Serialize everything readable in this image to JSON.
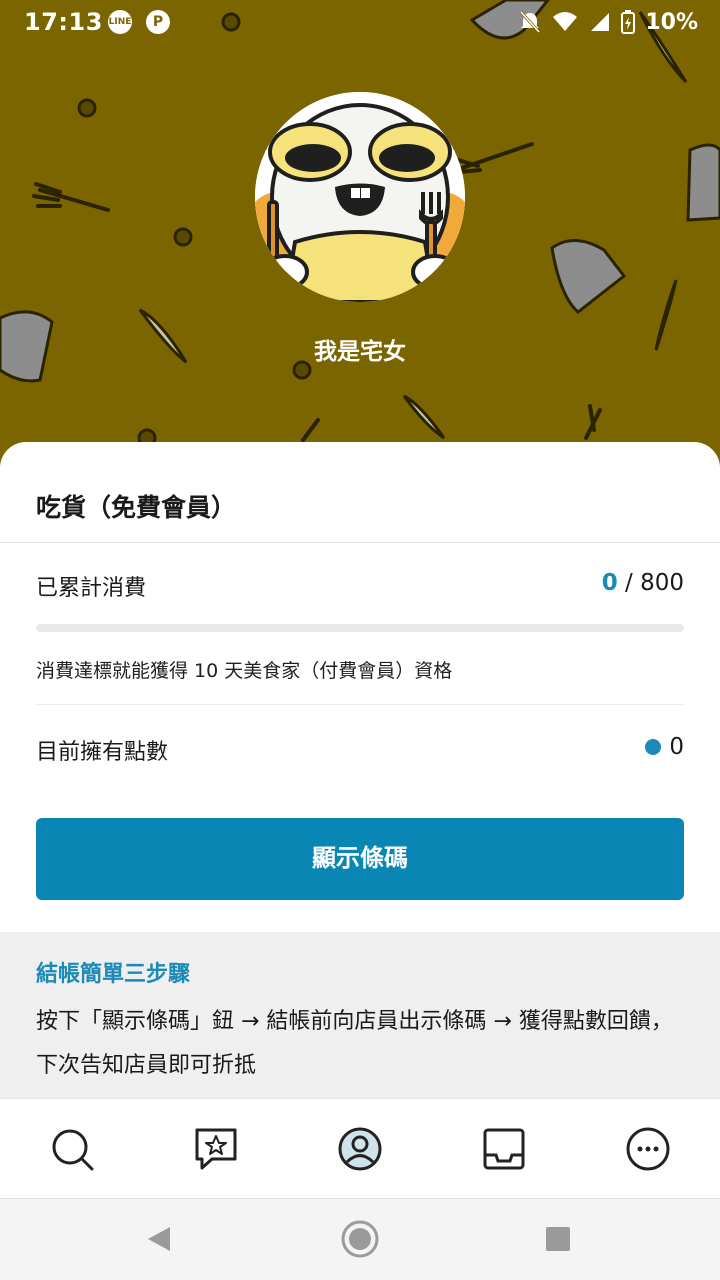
{
  "status_bar": {
    "time": "17:13",
    "app_icons": [
      "LINE",
      "P"
    ],
    "battery": "10%"
  },
  "profile": {
    "name": "我是宅女",
    "avatar_icon": "cartoon-avatar-icon"
  },
  "membership": {
    "title": "吃貨（免費會員）",
    "spend_label": "已累計消費",
    "spend_current": "0",
    "spend_target": "800",
    "spend_separator": " / ",
    "progress": 0,
    "note": "消費達標就能獲得 10 天美食家（付費會員）資格",
    "points_label": "目前擁有點數",
    "points_value": "0"
  },
  "barcode_button": "顯示條碼",
  "steps": {
    "title": "結帳簡單三步驟",
    "body": "按下「顯示條碼」鈕 → 結帳前向店員出示條碼 → 獲得點數回饋，下次告知店員即可折抵"
  },
  "nav": {
    "items": [
      "search-icon",
      "star-review-icon",
      "profile-icon",
      "inbox-icon",
      "more-icon"
    ],
    "active": "profile-icon"
  },
  "colors": {
    "hero_bg": "#7a6500",
    "accent": "#0a86b4",
    "steps_bg": "#efefef"
  }
}
